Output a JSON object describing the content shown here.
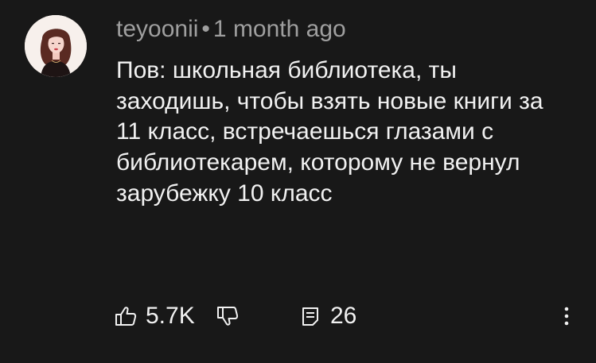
{
  "comment": {
    "author": "teyoonii",
    "separator": "•",
    "timestamp": "1 month ago",
    "text": "Пов: школьная библиотека, ты заходишь, чтобы взять новые книги за 11 класс, встречаешься глазами с библиотекарем, которому не вернул зарубежку 10 класс",
    "likes": "5.7K",
    "replies": "26"
  },
  "icons": {
    "like": "thumbs-up-icon",
    "dislike": "thumbs-down-icon",
    "reply": "reply-icon",
    "more": "more-vertical-icon"
  },
  "colors": {
    "background": "#181818",
    "text_primary": "#f1f1f1",
    "text_secondary": "#9f9f9f"
  }
}
